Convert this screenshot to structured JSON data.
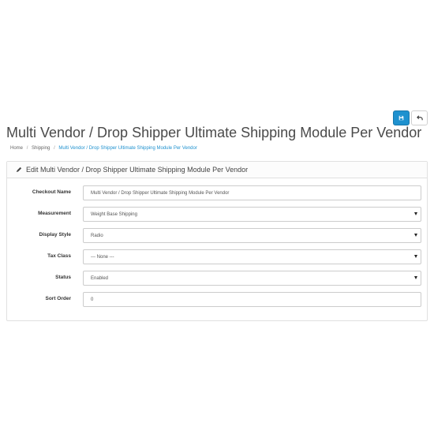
{
  "page": {
    "title": "Multi Vendor / Drop Shipper Ultimate Shipping Module Per Vendor"
  },
  "breadcrumb": [
    {
      "label": "Home"
    },
    {
      "label": "Shipping"
    },
    {
      "label": "Multi Vendor / Drop Shipper Ultimate Shipping Module Per Vendor"
    }
  ],
  "toolbar": {
    "save_icon": "save-icon",
    "back_icon": "back-arrow-icon"
  },
  "panel": {
    "heading": "Edit Multi Vendor / Drop Shipper Ultimate Shipping Module Per Vendor",
    "heading_icon": "pencil-icon"
  },
  "form": {
    "checkout_name": {
      "label": "Checkout Name",
      "value": "Multi Vendor / Drop Shipper Ultimate Shipping Module Per Vendor"
    },
    "measurement": {
      "label": "Measurement",
      "value": "Weight Base Shipping"
    },
    "display_style": {
      "label": "Display Style",
      "value": "Radio"
    },
    "tax_class": {
      "label": "Tax Class",
      "value": "--- None ---"
    },
    "status": {
      "label": "Status",
      "value": "Enabled"
    },
    "sort_order": {
      "label": "Sort Order",
      "value": "0"
    }
  },
  "colors": {
    "primary": "#1e91cf",
    "link": "#1e91cf",
    "border": "#e0e0e0"
  }
}
